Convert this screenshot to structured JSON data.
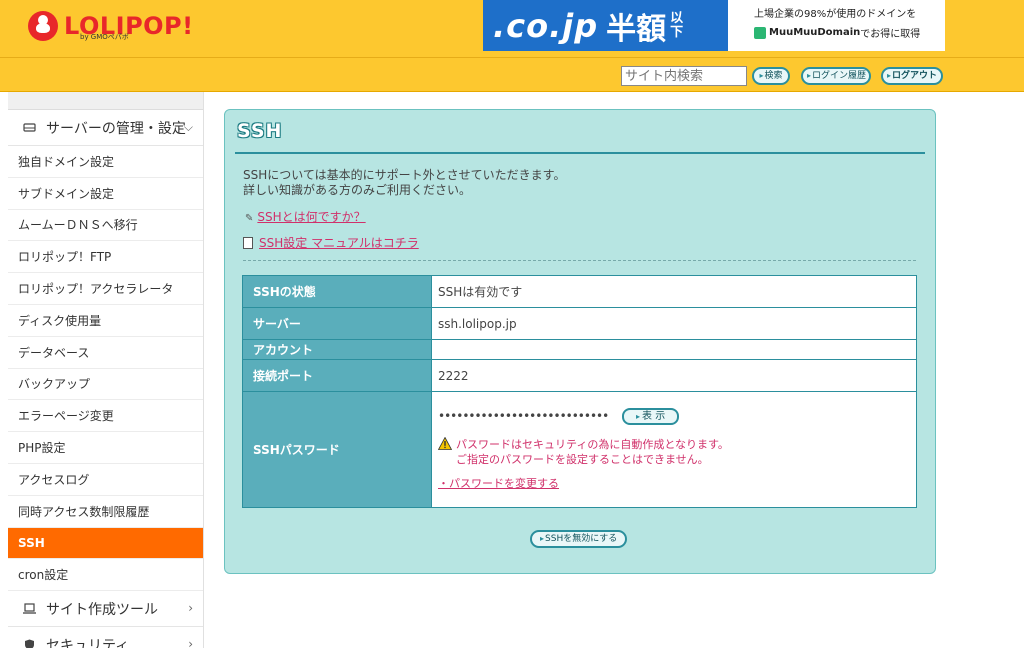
{
  "header": {
    "logo_text": "LOLIPOP!",
    "logo_sub": "by GMOペパボ",
    "banner": {
      "cojp": ".co.jp",
      "hangaku": "半額",
      "ika": "以下",
      "line1": "上場企業の98%が使用のドメインを",
      "brand": "MuuMuuDomain",
      "line2_tail": "でお得に取得"
    },
    "search_placeholder": "サイト内検索",
    "search_button": "検索",
    "history_button": "ログイン履歴",
    "logout_button": "ログアウト"
  },
  "sidebar": {
    "category_server": "サーバーの管理・設定",
    "items": [
      "独自ドメイン設定",
      "サブドメイン設定",
      "ムームーＤＮＳへ移行",
      "ロリポップ！FTP",
      "ロリポップ！アクセラレータ",
      "ディスク使用量",
      "データベース",
      "バックアップ",
      "エラーページ変更",
      "PHP設定",
      "アクセスログ",
      "同時アクセス数制限履歴",
      "SSH",
      "cron設定"
    ],
    "active_item": "SSH",
    "category_site_tools": "サイト作成ツール",
    "category_security": "セキュリティ"
  },
  "main": {
    "title": "SSH",
    "intro_line1": "SSHについては基本的にサポート外とさせていただきます。",
    "intro_line2": "詳しい知識がある方のみご利用ください。",
    "link_what": "SSHとは何ですか？",
    "link_manual": "SSH設定 マニュアルはコチラ",
    "table": {
      "status_label": "SSHの状態",
      "status_value": "SSHは有効です",
      "server_label": "サーバー",
      "server_value": "ssh.lolipop.jp",
      "account_label": "アカウント",
      "account_value": "",
      "port_label": "接続ポート",
      "port_value": "2222",
      "password_label": "SSHパスワード",
      "password_masked": "••••••••••••••••••••••••••••",
      "show_button": "表 示",
      "warning_line1": "パスワードはセキュリティの為に自動作成となります。",
      "warning_line2": "ご指定のパスワードを設定することはできません。",
      "change_link": "・パスワードを変更する"
    },
    "disable_button": "SSHを無効にする"
  }
}
